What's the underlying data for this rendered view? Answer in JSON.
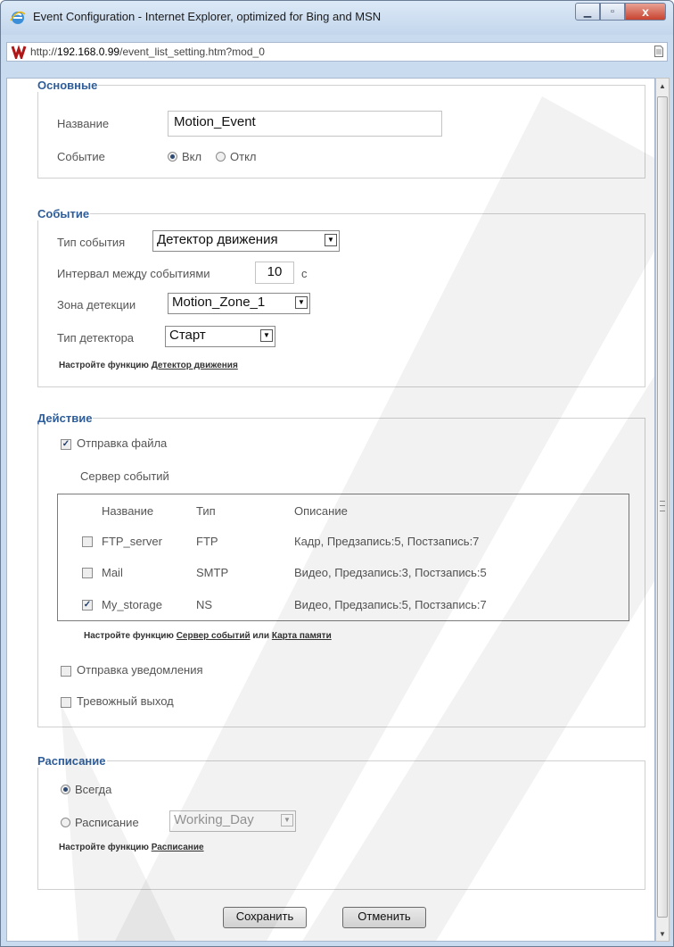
{
  "window": {
    "title": "Event Configuration - Internet Explorer, optimized for Bing and MSN",
    "url_prefix": "http://",
    "url_host": "192.168.0.99",
    "url_path": "/event_list_setting.htm?mod_0",
    "close_glyph": "x"
  },
  "general": {
    "legend": "Основные",
    "name_label": "Название",
    "name_value": "Motion_Event",
    "event_label": "Событие",
    "on_label": "Вкл",
    "off_label": "Откл",
    "event_state": "on"
  },
  "event": {
    "legend": "Событие",
    "type_label": "Тип события",
    "type_value": "Детектор движения",
    "interval_label": "Интервал между событиями",
    "interval_value": "10",
    "interval_unit": "с",
    "zone_label": "Зона детекции",
    "zone_value": "Motion_Zone_1",
    "detector_label": "Тип детектора",
    "detector_value": "Старт",
    "configure_text": "Настройте функцию",
    "configure_link": "Детектор движения"
  },
  "action": {
    "legend": "Действие",
    "send_file_label": "Отправка файла",
    "send_file_checked": true,
    "server_label": "Сервер событий",
    "columns": [
      "Название",
      "Тип",
      "Описание"
    ],
    "servers": [
      {
        "name": "FTP_server",
        "type": "FTP",
        "description": "Кадр, Предзапись:5, Постзапись:7",
        "checked": false
      },
      {
        "name": "Mail",
        "type": "SMTP",
        "description": "Видео, Предзапись:3, Постзапись:5",
        "checked": false
      },
      {
        "name": "My_storage",
        "type": "NS",
        "description": "Видео, Предзапись:5, Постзапись:7",
        "checked": true
      }
    ],
    "configure_text": "Настройте функцию",
    "configure_link1": "Сервер событий",
    "or_text": "или",
    "configure_link2": "Карта памяти",
    "notify_label": "Отправка уведомления",
    "notify_checked": false,
    "alarm_label": "Тревожный выход",
    "alarm_checked": false
  },
  "schedule": {
    "legend": "Расписание",
    "always_label": "Всегда",
    "schedule_label": "Расписание",
    "schedule_value": "Working_Day",
    "selected": "always",
    "configure_text": "Настройте функцию",
    "configure_link": "Расписание"
  },
  "buttons": {
    "save": "Сохранить",
    "cancel": "Отменить"
  },
  "icons": {
    "browser": "internet-explorer-icon",
    "site": "site-logo-icon",
    "page": "page-icon",
    "minimize": "minimize-icon",
    "maximize": "maximize-icon",
    "close": "close-icon"
  }
}
